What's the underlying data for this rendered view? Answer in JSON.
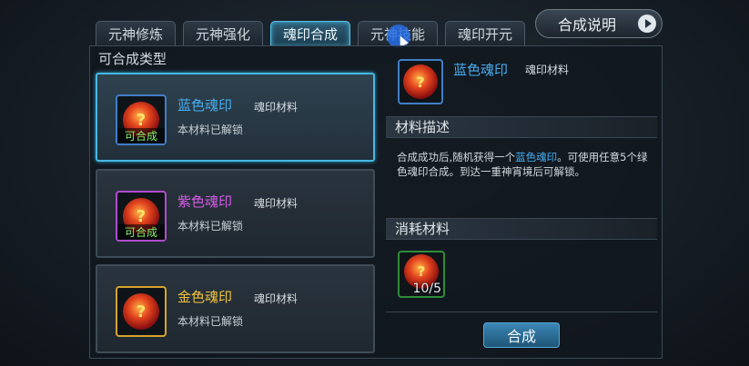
{
  "tabs": [
    {
      "label": "元神修炼"
    },
    {
      "label": "元神强化"
    },
    {
      "label": "魂印合成"
    },
    {
      "label": "元神技能"
    },
    {
      "label": "魂印开元"
    }
  ],
  "help_button": {
    "label": "合成说明"
  },
  "left_panel": {
    "title": "可合成类型",
    "cards": [
      {
        "name": "蓝色魂印",
        "type": "魂印材料",
        "status": "本材料已解锁",
        "badge": "可合成",
        "color": "#46aef0"
      },
      {
        "name": "紫色魂印",
        "type": "魂印材料",
        "status": "本材料已解锁",
        "badge": "可合成",
        "color": "#d65ce8"
      },
      {
        "name": "金色魂印",
        "type": "魂印材料",
        "status": "本材料已解锁",
        "badge": "",
        "color": "#f0c43a"
      }
    ]
  },
  "detail": {
    "name": "蓝色魂印",
    "type": "魂印材料",
    "desc_section": "材料描述",
    "desc_part1": "合成成功后,随机获得一个",
    "desc_highlight": "蓝色魂印",
    "desc_part2": "。可使用任意5个绿色魂印合成。到达一重神宵境后可解锁。",
    "cost_section": "消耗材料",
    "cost_count": "10/5",
    "merge_button": "合成"
  }
}
